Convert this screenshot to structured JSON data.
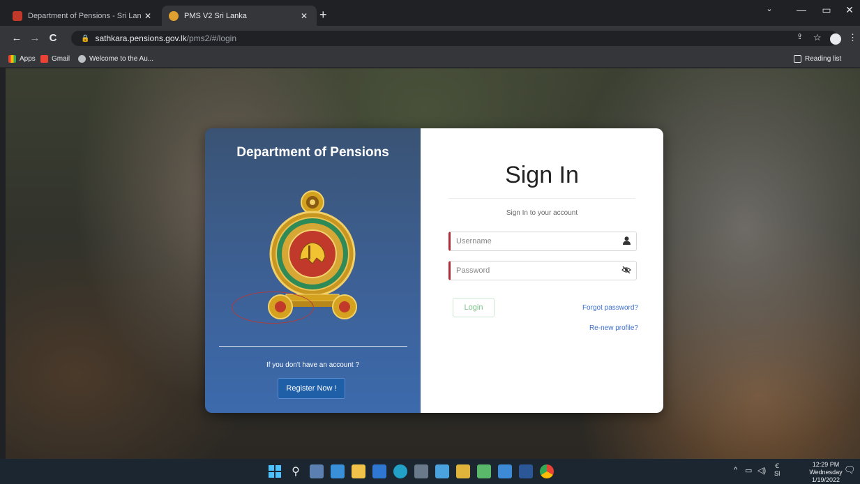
{
  "browser": {
    "tabs": [
      {
        "title": "Department of Pensions - Sri Lan",
        "active": false,
        "favicon_color": "#c0392b"
      },
      {
        "title": "PMS V2 Sri Lanka",
        "active": true,
        "favicon_color": "#e0a030"
      }
    ],
    "url_host": "sathkara.pensions.gov.lk",
    "url_path": "/pms2/#/login",
    "bookmarks": [
      {
        "label": "Apps",
        "icon": "apps-grid-icon"
      },
      {
        "label": "Gmail",
        "icon": "gmail-icon"
      },
      {
        "label": "Welcome to the Au...",
        "icon": "globe-icon"
      }
    ],
    "reading_list": "Reading list"
  },
  "left_panel": {
    "title": "Department of Pensions",
    "emblem": "sri-lanka-emblem",
    "no_account_text": "If you don't have an account ?",
    "register_label": "Register Now !"
  },
  "signin": {
    "title": "Sign In",
    "subtitle": "Sign In to your account",
    "username_placeholder": "Username",
    "password_placeholder": "Password",
    "login_label": "Login",
    "forgot_password": "Forgot password?",
    "renew_profile": "Re-new profile?"
  },
  "taskbar": {
    "time": "12:29 PM",
    "day": "Wednesday",
    "date": "1/19/2022",
    "lang_top": "Ꞓ",
    "lang": "SI"
  },
  "colors": {
    "accent_red": "#b02a37",
    "register_blue": "#1f5fa8",
    "link_blue": "#3a6fd1",
    "login_green": "#7bbf88"
  }
}
